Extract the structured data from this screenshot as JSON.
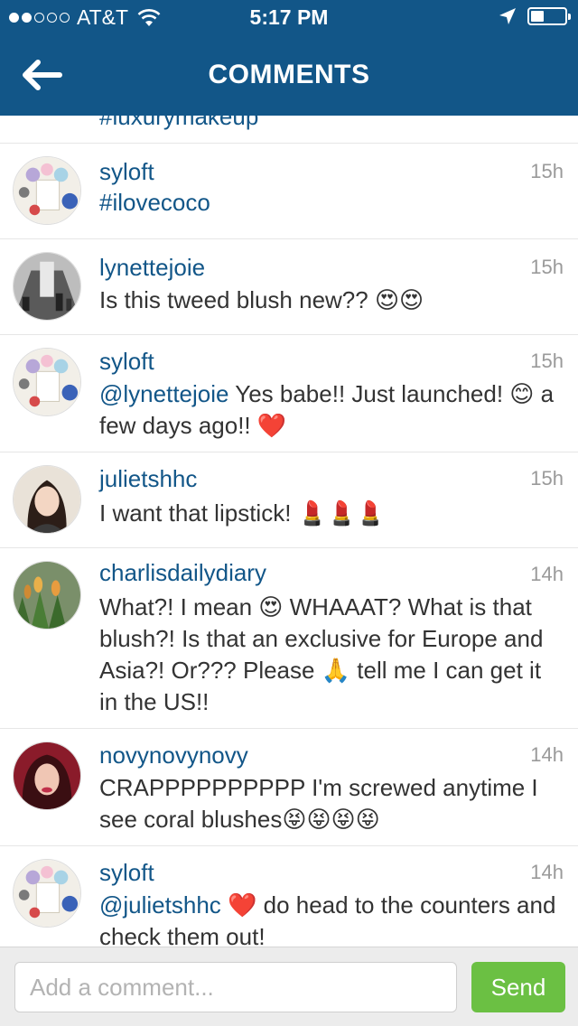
{
  "status_bar": {
    "carrier": "AT&T",
    "time": "5:17 PM"
  },
  "nav": {
    "title": "COMMENTS"
  },
  "partial_comment": {
    "text": "#luxurymakeup"
  },
  "comments": [
    {
      "username": "syloft",
      "time": "15h",
      "segments": [
        {
          "type": "tag",
          "text": "#ilovecoco"
        }
      ]
    },
    {
      "username": "lynettejoie",
      "time": "15h",
      "segments": [
        {
          "type": "text",
          "text": "Is this tweed blush new?? 😍😍"
        }
      ]
    },
    {
      "username": "syloft",
      "time": "15h",
      "segments": [
        {
          "type": "mention",
          "text": "@lynettejoie"
        },
        {
          "type": "text",
          "text": " Yes babe!! Just launched! 😊 a few days ago!! ❤️"
        }
      ]
    },
    {
      "username": "julietshhc",
      "time": "15h",
      "segments": [
        {
          "type": "text",
          "text": "I want that lipstick! 💄💄💄"
        }
      ]
    },
    {
      "username": "charlisdailydiary",
      "time": "14h",
      "segments": [
        {
          "type": "text",
          "text": "What?! I mean 😍 WHAAAT? What is that blush?! Is that an exclusive for Europe and Asia?! Or??? Please 🙏 tell me I can get it in the US!!"
        }
      ]
    },
    {
      "username": "novynovynovy",
      "time": "14h",
      "segments": [
        {
          "type": "text",
          "text": "CRAPPPPPPPPPP I'm screwed anytime I see coral blushes😝😝😝😝"
        }
      ]
    },
    {
      "username": "syloft",
      "time": "14h",
      "segments": [
        {
          "type": "mention",
          "text": "@julietshhc"
        },
        {
          "type": "text",
          "text": " ❤️ do head to the counters and check them out!"
        }
      ]
    }
  ],
  "composer": {
    "placeholder": "Add a comment...",
    "send_label": "Send"
  },
  "colors": {
    "header": "#125688",
    "link": "#125688",
    "send": "#6bc043"
  }
}
